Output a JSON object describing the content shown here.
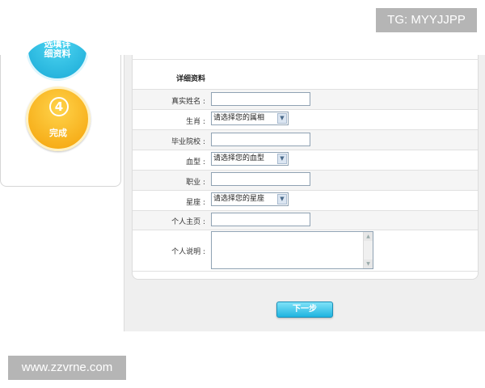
{
  "watermarks": {
    "top": "TG: MYYJJPP",
    "bottom": "www.zzvrne.com"
  },
  "steps": {
    "step3": {
      "line1": "选填详",
      "line2": "细资料"
    },
    "step4": {
      "number": "4",
      "label": "完成"
    }
  },
  "form": {
    "section_title": "详细资料",
    "fields": {
      "real_name": {
        "label": "真实姓名",
        "value": ""
      },
      "zodiac": {
        "label": "生肖",
        "selected": "请选择您的属相"
      },
      "school": {
        "label": "毕业院校",
        "value": ""
      },
      "blood_type": {
        "label": "血型",
        "selected": "请选择您的血型"
      },
      "occupation": {
        "label": "职业",
        "value": ""
      },
      "constellation": {
        "label": "星座",
        "selected": "请选择您的星座"
      },
      "homepage": {
        "label": "个人主页",
        "value": ""
      },
      "bio": {
        "label": "个人说明",
        "value": ""
      }
    },
    "next_button": "下一步"
  },
  "icons": {
    "select_arrow": "chevron-down-icon",
    "scroll_up": "arrow-up-icon",
    "scroll_down": "arrow-down-icon"
  },
  "colors": {
    "accent_blue": "#1fb4e0",
    "step_orange": "#f4a20a",
    "step_cyan": "#19a9d6"
  }
}
